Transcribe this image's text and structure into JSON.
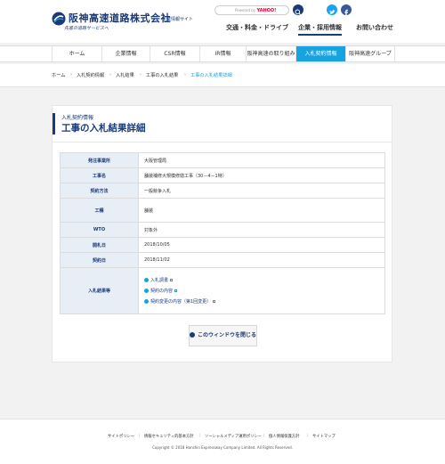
{
  "header": {
    "logo_main": "阪神高速道路株式会社",
    "logo_sub": "企業情報サイト",
    "logo_tagline": "先進の道路サービスへ",
    "search_hint_prefix": "Powered by",
    "search_hint_brand": "YAHOO!",
    "top_nav": [
      "交通・料金・ドライブ",
      "企業・採用情報",
      "お問い合わせ"
    ],
    "top_nav_active": "企業・採用情報"
  },
  "main_nav": {
    "items": [
      "ホーム",
      "企業情報",
      "CSR情報",
      "IR情報",
      "阪神高速の取り組み",
      "入札契約情報",
      "阪神高速グループ"
    ],
    "active": "入札契約情報"
  },
  "breadcrumb": [
    "ホーム",
    "入札契約情報",
    "入札結果",
    "工事の入札結果",
    "工事の入札結果詳細"
  ],
  "page": {
    "category": "入札契約情報",
    "title": "工事の入札結果詳細"
  },
  "details": [
    {
      "label": "発注事業所",
      "value": "大阪管理局"
    },
    {
      "label": "工事名",
      "value": "舗装補修大規模修繕工事（30－4－1特）"
    },
    {
      "label": "契約方法",
      "value": "一般競争入札"
    },
    {
      "label": "工種",
      "value": "舗装"
    },
    {
      "label": "WTO",
      "value": "対象外"
    },
    {
      "label": "開札日",
      "value": "2018/10/05"
    },
    {
      "label": "契約日",
      "value": "2018/11/02"
    }
  ],
  "results": {
    "label": "入札結果等",
    "links": [
      "入札調書",
      "契約の内容",
      "契約変更の内容（第1回変更）"
    ]
  },
  "close_button": "このウィンドウを閉じる",
  "footer": {
    "links": [
      "サイトポリシー",
      "情報セキュリティ的基本方針",
      "ソーシャルメディア運用ポリシー",
      "個人情報保護方針",
      "サイトマップ"
    ],
    "copyright": "Copyright © 2018 Hanshin Expressway Company Limited. All Rights Reserved."
  },
  "colors": {
    "brand_navy": "#1b3a78",
    "accent_blue": "#18a3e0",
    "table_header_bg": "#e8eef6"
  }
}
